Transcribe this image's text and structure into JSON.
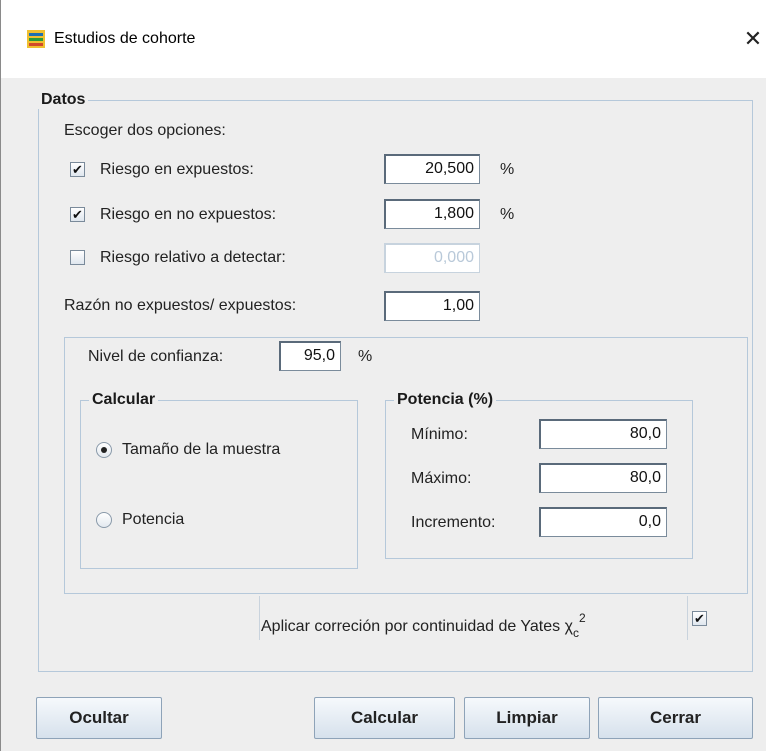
{
  "window": {
    "title": "Estudios de cohorte",
    "close_glyph": "✕",
    "app_icon": "cohort-study-icon"
  },
  "datos": {
    "legend": "Datos",
    "instruction": "Escoger dos opciones:",
    "options": [
      {
        "label": "Riesgo en expuestos:",
        "checked": true,
        "value": "20,500",
        "unit": "%"
      },
      {
        "label": "Riesgo en no expuestos:",
        "checked": true,
        "value": "1,800",
        "unit": "%"
      },
      {
        "label": "Riesgo relativo a detectar:",
        "checked": false,
        "value": "0,000",
        "unit": ""
      }
    ],
    "ratio": {
      "label": "Razón no expuestos/ expuestos:",
      "value": "1,00"
    }
  },
  "confianza": {
    "label": "Nivel de confianza:",
    "value": "95,0",
    "unit": "%"
  },
  "calcular_group": {
    "legend": "Calcular",
    "options": [
      {
        "label": "Tamaño de la muestra",
        "selected": true
      },
      {
        "label": "Potencia",
        "selected": false
      }
    ]
  },
  "potencia_group": {
    "legend": "Potencia (%)",
    "rows": [
      {
        "label": "Mínimo:",
        "value": "80,0"
      },
      {
        "label": "Máximo:",
        "value": "80,0"
      },
      {
        "label": "Incremento:",
        "value": "0,0"
      }
    ]
  },
  "yates": {
    "label": "Aplicar correción por continuidad de Yates",
    "symbol": "χ",
    "subscript": "c",
    "superscript": "2",
    "checked": true
  },
  "buttons": {
    "ocultar": "Ocultar",
    "calcular": "Calcular",
    "limpiar": "Limpiar",
    "cerrar": "Cerrar"
  },
  "glyphs": {
    "check": "✔"
  }
}
